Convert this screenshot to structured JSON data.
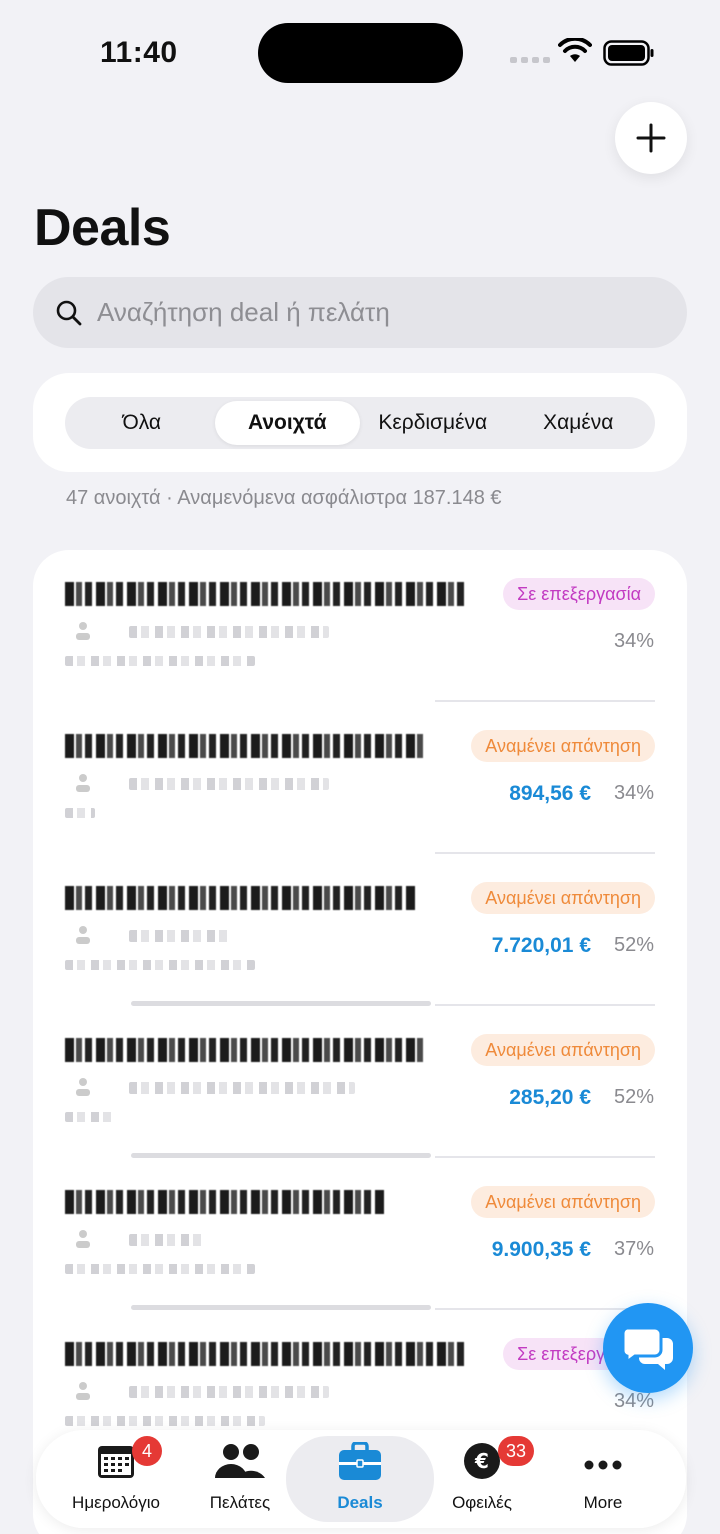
{
  "status_bar": {
    "time": "11:40"
  },
  "header": {
    "title": "Deals"
  },
  "search": {
    "placeholder": "Αναζήτηση deal ή πελάτη"
  },
  "filters": {
    "tabs": [
      {
        "label": "Όλα"
      },
      {
        "label": "Ανοιχτά",
        "selected": true
      },
      {
        "label": "Κερδισμένα"
      },
      {
        "label": "Χαμένα"
      }
    ]
  },
  "summary": "47 ανοιχτά · Αναμενόμενα ασφάλιστρα 187.148 €",
  "deals": [
    {
      "status": "Σε επεξεργασία",
      "status_kind": "processing",
      "amount": "",
      "percent": "34%"
    },
    {
      "status": "Αναμένει απάντηση",
      "status_kind": "waiting",
      "amount": "894,56 €",
      "percent": "34%"
    },
    {
      "status": "Αναμένει απάντηση",
      "status_kind": "waiting",
      "amount": "7.720,01 €",
      "percent": "52%"
    },
    {
      "status": "Αναμένει απάντηση",
      "status_kind": "waiting",
      "amount": "285,20 €",
      "percent": "52%"
    },
    {
      "status": "Αναμένει απάντηση",
      "status_kind": "waiting",
      "amount": "9.900,35 €",
      "percent": "37%"
    },
    {
      "status": "Σε επεξεργασία",
      "status_kind": "processing",
      "amount": "",
      "percent": "34%"
    }
  ],
  "tabbar": {
    "items": [
      {
        "label": "Ημερολόγιο",
        "badge": "4",
        "icon": "calendar-icon"
      },
      {
        "label": "Πελάτες",
        "badge": "",
        "icon": "people-icon"
      },
      {
        "label": "Deals",
        "badge": "",
        "icon": "briefcase-icon",
        "active": true
      },
      {
        "label": "Οφειλές",
        "badge": "33",
        "icon": "euro-icon"
      },
      {
        "label": "More",
        "badge": "",
        "icon": "more-icon"
      }
    ]
  },
  "colors": {
    "accent": "#1a8ad6",
    "processing_bg": "#f7e3f7",
    "processing_fg": "#c23bc2",
    "waiting_bg": "#fdecdf",
    "waiting_fg": "#ef8a3a",
    "badge_red": "#e53935",
    "chat_fab": "#2196f3"
  }
}
